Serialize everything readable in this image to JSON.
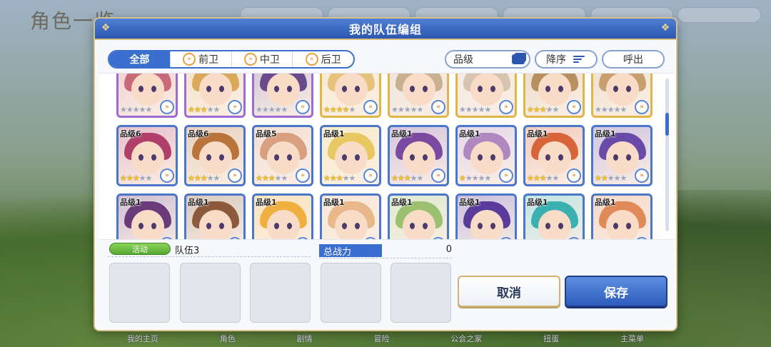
{
  "background": {
    "screen_title": "角色一览",
    "bottom_nav": [
      "我的主页",
      "角色",
      "剧情",
      "冒险",
      "公会之家",
      "扭蛋",
      "主菜单"
    ]
  },
  "modal": {
    "title": "我的队伍编组",
    "filter_tabs": [
      {
        "label": "全部",
        "active": true
      },
      {
        "label": "前卫",
        "active": false
      },
      {
        "label": "中卫",
        "active": false
      },
      {
        "label": "后卫",
        "active": false
      }
    ],
    "sort_key": "品级",
    "sort_order": "降序",
    "call_label": "呼出",
    "roster": [
      {
        "level": "",
        "stars": 0,
        "frame": "purple",
        "hair": "#c86a7a"
      },
      {
        "level": "",
        "stars": 3,
        "frame": "purple",
        "hair": "#d9a85a"
      },
      {
        "level": "",
        "stars": 0,
        "frame": "purple",
        "hair": "#6a4a8a"
      },
      {
        "level": "",
        "stars": 4,
        "frame": "gold",
        "hair": "#e6c27a"
      },
      {
        "level": "",
        "stars": 0,
        "frame": "gold",
        "hair": "#c9b090"
      },
      {
        "level": "",
        "stars": 0,
        "frame": "gold",
        "hair": "#d8c2b0"
      },
      {
        "level": "",
        "stars": 3,
        "frame": "gold",
        "hair": "#b89060"
      },
      {
        "level": "",
        "stars": 0,
        "frame": "gold",
        "hair": "#c8a070"
      },
      {
        "level": "品级6",
        "stars": 3,
        "frame": "blue",
        "hair": "#b0406a"
      },
      {
        "level": "品级6",
        "stars": 3,
        "frame": "blue",
        "hair": "#b8743a"
      },
      {
        "level": "品级5",
        "stars": 3,
        "frame": "blue",
        "hair": "#d9a080"
      },
      {
        "level": "品级1",
        "stars": 3,
        "frame": "blue",
        "hair": "#e8c860"
      },
      {
        "level": "品级1",
        "stars": 3,
        "frame": "blue",
        "hair": "#7a4aa0"
      },
      {
        "level": "品级1",
        "stars": 1,
        "frame": "blue",
        "hair": "#b088c0"
      },
      {
        "level": "品级1",
        "stars": 3,
        "frame": "blue",
        "hair": "#d8643a"
      },
      {
        "level": "品级1",
        "stars": 2,
        "frame": "blue",
        "hair": "#6a4aa8"
      },
      {
        "level": "品级1",
        "stars": 3,
        "frame": "blue",
        "hair": "#6a3a7a"
      },
      {
        "level": "品级1",
        "stars": 1,
        "frame": "blue",
        "hair": "#8a5a3a"
      },
      {
        "level": "品级1",
        "stars": 1,
        "frame": "blue",
        "hair": "#f0b040"
      },
      {
        "level": "品级1",
        "stars": 3,
        "frame": "blue",
        "hair": "#e8b88a"
      },
      {
        "level": "品级1",
        "stars": 1,
        "frame": "blue",
        "hair": "#9ac070"
      },
      {
        "level": "品级1",
        "stars": 3,
        "frame": "blue",
        "hair": "#5a3a9a"
      },
      {
        "level": "品级1",
        "stars": 3,
        "frame": "blue",
        "hair": "#3ab0b0"
      },
      {
        "level": "品级1",
        "stars": 2,
        "frame": "blue",
        "hair": "#e08a5a"
      }
    ],
    "activity_badge": "活动",
    "team_name": "队伍3",
    "power_label": "总战力",
    "power_value": "0",
    "cancel_label": "取消",
    "save_label": "保存"
  }
}
